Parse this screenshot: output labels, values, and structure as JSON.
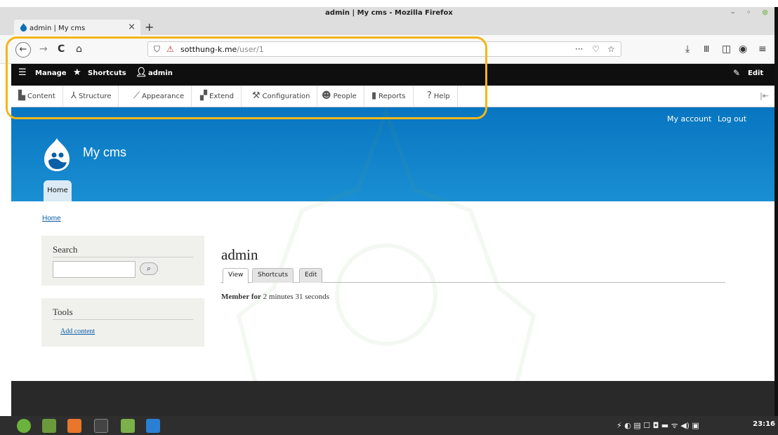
{
  "window": {
    "title": "admin | My cms - Mozilla Firefox",
    "min": "–",
    "max": "◦",
    "close": "⊗"
  },
  "tab": {
    "label": "admin | My cms",
    "close": "×",
    "new": "+"
  },
  "nav": {
    "back": "←",
    "forward": "→",
    "reload": "C",
    "home": "⌂",
    "url_host": "sotthung-k.me",
    "url_path": "/user/1",
    "more": "···",
    "pocket": "♡",
    "star": "☆",
    "download": "⤓",
    "library": "Ⅲ",
    "sidebar": "◫",
    "account": "◉",
    "menu": "≡"
  },
  "toolbar": {
    "manage": "Manage",
    "shortcuts": "Shortcuts",
    "user": "admin",
    "edit": "Edit"
  },
  "tray": [
    {
      "label": "Content",
      "icon": "▙"
    },
    {
      "label": "Structure",
      "icon": "⅄"
    },
    {
      "label": "Appearance",
      "icon": "⟋"
    },
    {
      "label": "Extend",
      "icon": "▞"
    },
    {
      "label": "Configuration",
      "icon": "⚒"
    },
    {
      "label": "People",
      "icon": "☻"
    },
    {
      "label": "Reports",
      "icon": "▮"
    },
    {
      "label": "Help",
      "icon": "?"
    }
  ],
  "header": {
    "my_account": "My account",
    "logout": "Log out",
    "site_name": "My cms",
    "home_tab": "Home"
  },
  "breadcrumb": "Home",
  "search": {
    "title": "Search",
    "button": "⌕"
  },
  "tools": {
    "title": "Tools",
    "link": "Add content"
  },
  "page": {
    "title": "admin",
    "tabs": [
      "View",
      "Shortcuts",
      "Edit"
    ],
    "member_label": "Member for",
    "member_value": "2 minutes 31 seconds"
  },
  "taskbar": {
    "clock": "23:16",
    "tray": "⚡ ◐ ▤ ☐ ◘ ▬ ᯤ ◀) ▣"
  },
  "colors": {
    "accent": "#f3b616",
    "header": "#0875c0",
    "toolbar": "#0f0f0f"
  }
}
